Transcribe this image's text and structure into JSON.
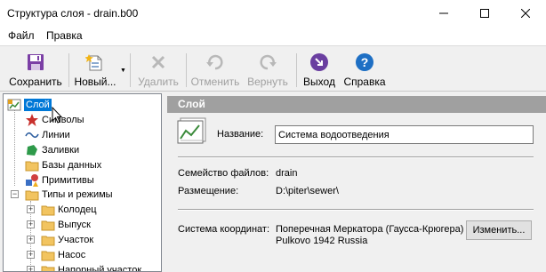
{
  "window": {
    "title": "Структура слоя - drain.b00"
  },
  "menu": {
    "items": [
      "Файл",
      "Правка"
    ]
  },
  "toolbar": {
    "save_label": "Сохранить",
    "new_label": "Новый...",
    "delete_label": "Удалить",
    "undo_label": "Отменить",
    "redo_label": "Вернуть",
    "exit_label": "Выход",
    "help_label": "Справка"
  },
  "tree": {
    "root": "Слой",
    "items": [
      "Символы",
      "Линии",
      "Заливки",
      "Базы данных",
      "Примитивы"
    ],
    "types_folder": "Типы и режимы",
    "types": [
      "Колодец",
      "Выпуск",
      "Участок",
      "Насос",
      "Напорный участок"
    ]
  },
  "panel": {
    "header": "Слой",
    "name_label": "Название:",
    "name_value": "Система водоотведения",
    "family_label": "Семейство файлов:",
    "family_value": "drain",
    "location_label": "Размещение:",
    "location_value": "D:\\piter\\sewer\\",
    "coord_label": "Система координат:",
    "coord_line1": "Поперечная Меркатора (Гаусса-Крюгера)",
    "coord_line2": "Pulkovo 1942 Russia",
    "change_button": "Изменить..."
  },
  "colors": {
    "selection": "#0078d7",
    "panel_header": "#a0a0a0",
    "exit_icon": "#6a3fa0",
    "help_icon": "#1e6fc4"
  }
}
